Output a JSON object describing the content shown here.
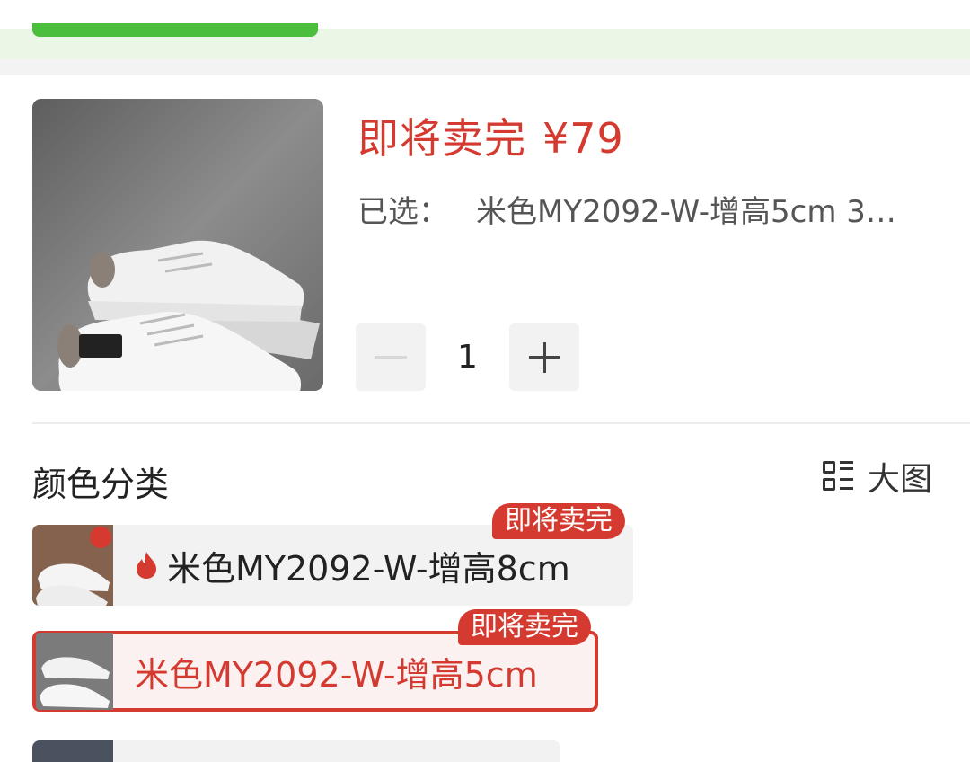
{
  "product": {
    "price_line": "即将卖完 ¥79",
    "status": "即将卖完",
    "price": "¥79",
    "selected_label": "已选：",
    "selected_value": "米色MY2092-W-增高5cm 3…",
    "quantity": "1"
  },
  "section": {
    "title": "颜色分类",
    "bigview_label": "大图"
  },
  "options": [
    {
      "label": "米色MY2092-W-增高8cm",
      "badge": "即将卖完",
      "hot": true,
      "selected": false
    },
    {
      "label": "米色MY2092-W-增高5cm",
      "badge": "即将卖完",
      "hot": false,
      "selected": true
    }
  ],
  "colors": {
    "accent_red": "#d43a2f",
    "green": "#4cbe3d"
  }
}
